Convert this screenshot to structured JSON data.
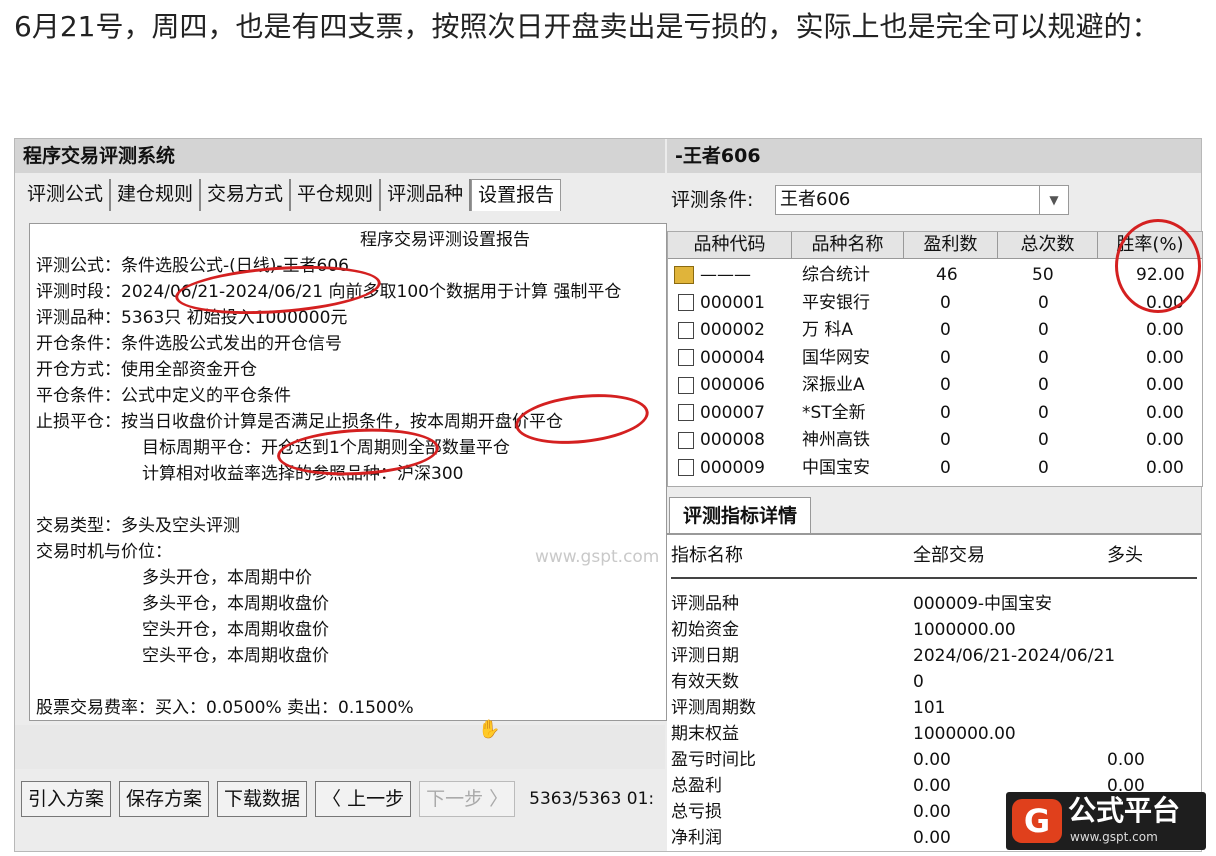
{
  "caption": "6月21号，周四，也是有四支票，按照次日开盘卖出是亏损的，实际上也是完全可以规避的：",
  "left_panel": {
    "title": "程序交易评测系统",
    "tabs": [
      "评测公式",
      "建仓规则",
      "交易方式",
      "平仓规则",
      "评测品种",
      "设置报告"
    ],
    "report_lines": [
      "程序交易评测设置报告",
      "评测公式：条件选股公式-(日线)-王者606",
      "评测时段：2024/06/21-2024/06/21 向前多取100个数据用于计算 强制平仓",
      "评测品种：5363只 初始投入1000000元",
      "开仓条件：条件选股公式发出的开仓信号",
      "开仓方式：使用全部资金开仓",
      "平仓条件：公式中定义的平仓条件",
      "止损平仓：按当日收盘价计算是否满足止损条件，按本周期开盘价平仓",
      "目标周期平仓：开仓达到1个周期则全部数量平仓",
      "计算相对收益率选择的参照品种：沪深300",
      "交易类型：多头及空头评测",
      "交易时机与价位：",
      "多头开仓，本周期中价",
      "多头平仓，本周期收盘价",
      "空头开仓，本周期收盘价",
      "空头平仓，本周期收盘价",
      "股票交易费率：买入：0.0500%  卖出：0.1500%"
    ],
    "watermark": "www.gspt.com",
    "buttons": [
      "引入方案",
      "保存方案",
      "下载数据",
      "〈 上一步",
      "下一步 〉"
    ],
    "status": "5363/5363 01:"
  },
  "right_panel": {
    "title": "-王者606",
    "condition_label": "评测条件:",
    "condition_value": "王者606",
    "grid_headers": [
      "品种代码",
      "品种名称",
      "盈利数",
      "总次数",
      "胜率(%)"
    ],
    "grid_rows": [
      {
        "code": "———",
        "name": "综合统计",
        "win": "46",
        "total": "50",
        "rate": "92.00"
      },
      {
        "code": "000001",
        "name": "平安银行",
        "win": "0",
        "total": "0",
        "rate": "0.00"
      },
      {
        "code": "000002",
        "name": "万 科A",
        "win": "0",
        "total": "0",
        "rate": "0.00"
      },
      {
        "code": "000004",
        "name": "国华网安",
        "win": "0",
        "total": "0",
        "rate": "0.00"
      },
      {
        "code": "000006",
        "name": "深振业A",
        "win": "0",
        "total": "0",
        "rate": "0.00"
      },
      {
        "code": "000007",
        "name": "*ST全新",
        "win": "0",
        "total": "0",
        "rate": "0.00"
      },
      {
        "code": "000008",
        "name": "神州高铁",
        "win": "0",
        "total": "0",
        "rate": "0.00"
      },
      {
        "code": "000009",
        "name": "中国宝安",
        "win": "0",
        "total": "0",
        "rate": "0.00"
      }
    ],
    "detail_tab": "评测指标详情",
    "detail_headers": [
      "指标名称",
      "全部交易",
      "多头"
    ],
    "detail_rows": [
      {
        "name": "评测品种",
        "all": "000009-中国宝安",
        "long": ""
      },
      {
        "name": "初始资金",
        "all": "1000000.00",
        "long": ""
      },
      {
        "name": "评测日期",
        "all": "2024/06/21-2024/06/21",
        "long": ""
      },
      {
        "name": "有效天数",
        "all": "0",
        "long": ""
      },
      {
        "name": "评测周期数",
        "all": "101",
        "long": ""
      },
      {
        "name": "期末权益",
        "all": "1000000.00",
        "long": ""
      },
      {
        "name": "盈亏时间比",
        "all": "0.00",
        "long": "0.00"
      },
      {
        "name": "总盈利",
        "all": "0.00",
        "long": "0.00"
      },
      {
        "name": "总亏损",
        "all": "0.00",
        "long": ""
      },
      {
        "name": "净利润",
        "all": "0.00",
        "long": ""
      }
    ]
  },
  "logo": {
    "mark": "G",
    "text": "公式平台",
    "url": "www.gspt.com"
  },
  "colors": {
    "annotation": "#d42020",
    "logo_accent": "#e0401c",
    "title_bar": "#d4d4d4"
  }
}
